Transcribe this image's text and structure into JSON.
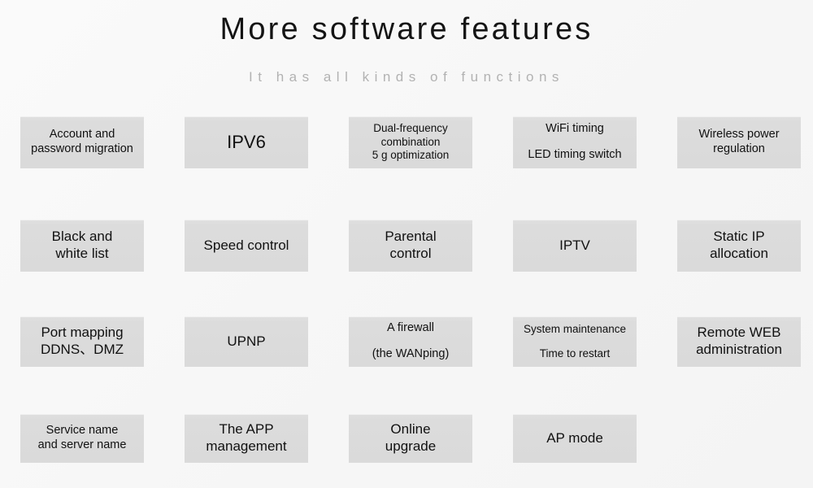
{
  "header": {
    "title": "More software features",
    "subtitle": "It has all kinds of functions"
  },
  "theme": {
    "background": "#f7f7f7",
    "box_fill": "#dcdcdc",
    "title_color": "#141414",
    "subtitle_color": "#b2b2b2",
    "box_text_color": "#111111"
  },
  "grid": {
    "columns": 5,
    "rows": 4,
    "features": [
      [
        {
          "lines": [
            "Account and",
            "password migration"
          ],
          "size": "sm",
          "spacing": "tight"
        },
        {
          "lines": [
            "IPV6"
          ],
          "size": "lg",
          "spacing": "tight"
        },
        {
          "lines": [
            "Dual-frequency",
            "combination",
            "5 g optimization"
          ],
          "size": "xs",
          "spacing": "tight"
        },
        {
          "lines": [
            "WiFi timing",
            "LED timing switch"
          ],
          "size": "sm",
          "spacing": "spaced"
        },
        {
          "lines": [
            "Wireless power",
            "regulation"
          ],
          "size": "sm",
          "spacing": "tight"
        }
      ],
      [
        {
          "lines": [
            "Black and",
            "white list"
          ],
          "size": "md",
          "spacing": "tight"
        },
        {
          "lines": [
            "Speed control"
          ],
          "size": "md",
          "spacing": "tight"
        },
        {
          "lines": [
            "Parental",
            "control"
          ],
          "size": "md",
          "spacing": "tight"
        },
        {
          "lines": [
            "IPTV"
          ],
          "size": "md",
          "spacing": "tight"
        },
        {
          "lines": [
            "Static IP",
            "allocation"
          ],
          "size": "md",
          "spacing": "tight"
        }
      ],
      [
        {
          "lines": [
            "Port mapping",
            "DDNS、DMZ"
          ],
          "size": "md",
          "spacing": "tight"
        },
        {
          "lines": [
            "UPNP"
          ],
          "size": "md",
          "spacing": "tight"
        },
        {
          "lines": [
            "A firewall",
            "(the WANping)"
          ],
          "size": "sm",
          "spacing": "spaced"
        },
        {
          "lines": [
            "System maintenance",
            "Time to restart"
          ],
          "size": "xs",
          "spacing": "spaced"
        },
        {
          "lines": [
            "Remote WEB",
            "administration"
          ],
          "size": "md",
          "spacing": "tight"
        }
      ],
      [
        {
          "lines": [
            "Service name",
            "and server name"
          ],
          "size": "sm",
          "spacing": "tight"
        },
        {
          "lines": [
            "The APP",
            "management"
          ],
          "size": "md",
          "spacing": "tight"
        },
        {
          "lines": [
            "Online",
            "upgrade"
          ],
          "size": "md",
          "spacing": "tight"
        },
        {
          "lines": [
            "AP mode"
          ],
          "size": "md",
          "spacing": "tight"
        },
        null
      ]
    ]
  }
}
